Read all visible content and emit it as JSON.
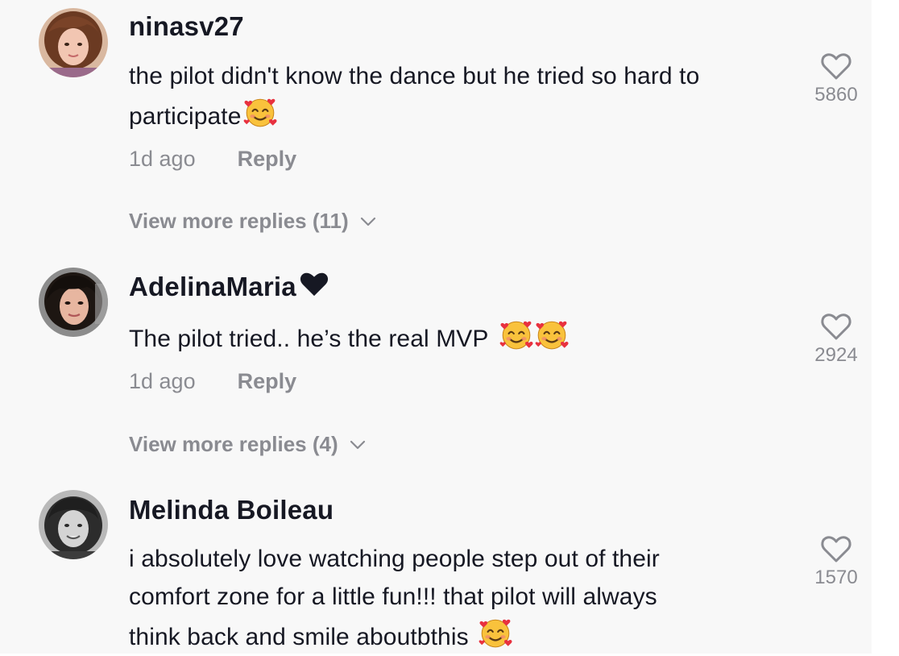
{
  "comments": [
    {
      "username": "ninasv27",
      "text": "the pilot didn't know the dance but he tried so hard to participate",
      "emoji": "smiling-face-with-hearts",
      "time": "1d ago",
      "reply_label": "Reply",
      "view_more": "View more replies (11)",
      "likes": "5860"
    },
    {
      "username": "AdelinaMaria",
      "username_suffix_icon": "black-heart",
      "text": "The pilot tried.. he’s the real MVP",
      "emoji": "smiling-face-with-hearts",
      "time": "1d ago",
      "reply_label": "Reply",
      "view_more": "View more replies (4)",
      "likes": "2924"
    },
    {
      "username": "Melinda Boileau",
      "text_lines": [
        "i absolutely love watching people step out of their",
        "comfort zone for a little fun!!! that pilot will always",
        "think back and smile aboutbthis"
      ],
      "emoji": "smiling-face-with-hearts",
      "likes": "1570"
    }
  ],
  "colors": {
    "background": "#f8f8f8",
    "primary_text": "#161823",
    "secondary_text": "#8a8b91",
    "emoji_face": "#f9c23c",
    "emoji_heart": "#e8313f"
  }
}
